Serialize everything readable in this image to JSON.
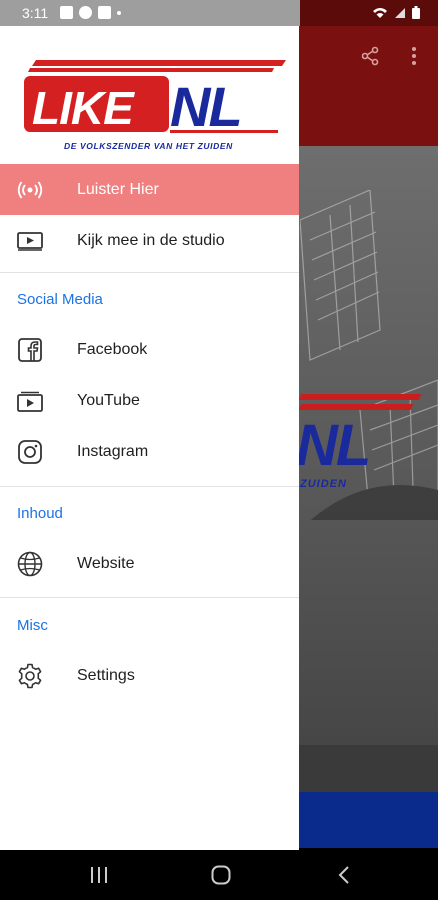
{
  "status_bar": {
    "time": "3:11",
    "icons": [
      "image-icon",
      "play-icon",
      "youtube-icon",
      "dot-icon"
    ],
    "right_icons": [
      "wifi-icon",
      "signal-icon",
      "battery-icon"
    ]
  },
  "app": {
    "toolbar_icons": [
      "share-icon",
      "more-vert-icon"
    ],
    "hero_logo_text": "NL",
    "hero_logo_subtext": "ZUIDEN"
  },
  "drawer": {
    "logo": {
      "text_like": "LIKE",
      "text_nl": "NL",
      "tagline": "DE VOLKSZENDER VAN HET ZUIDEN"
    },
    "items": [
      {
        "label": "Luister Hier",
        "icon": "radio-broadcast-icon",
        "active": true
      },
      {
        "label": "Kijk mee in de studio",
        "icon": "tv-play-icon",
        "active": false
      }
    ],
    "sections": [
      {
        "title": "Social Media",
        "items": [
          {
            "label": "Facebook",
            "icon": "facebook-icon"
          },
          {
            "label": "YouTube",
            "icon": "youtube-icon"
          },
          {
            "label": "Instagram",
            "icon": "instagram-icon"
          }
        ]
      },
      {
        "title": "Inhoud",
        "items": [
          {
            "label": "Website",
            "icon": "globe-icon"
          }
        ]
      },
      {
        "title": "Misc",
        "items": [
          {
            "label": "Settings",
            "icon": "gear-icon"
          }
        ]
      }
    ]
  },
  "colors": {
    "active_bg": "#f08080",
    "section_header": "#1a73e8",
    "logo_red": "#d42020",
    "logo_blue": "#1a2a9c"
  },
  "nav_bar": {
    "buttons": [
      "recents-icon",
      "home-icon",
      "back-icon"
    ]
  }
}
